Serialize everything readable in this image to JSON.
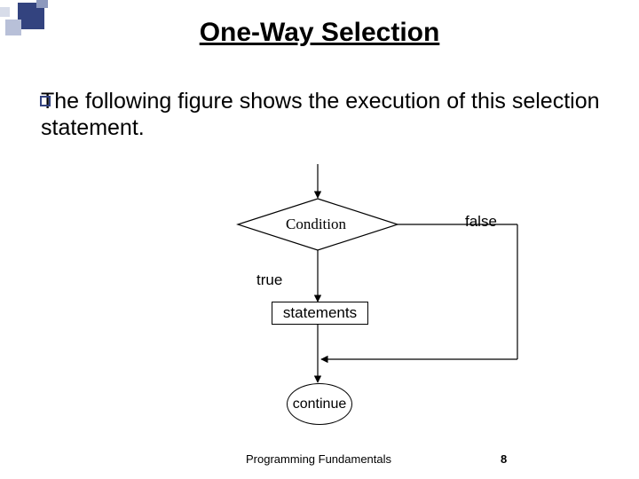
{
  "title": "One-Way Selection",
  "body": "The following figure shows the execution of this selection statement.",
  "flow": {
    "condition": "Condition",
    "true_label": "true",
    "false_label": "false",
    "statements": "statements",
    "continue": "continue"
  },
  "footer": {
    "text": "Programming Fundamentals",
    "page": "8"
  },
  "deco": {
    "c1": "#3c4f8a",
    "c2": "#9aa6c4",
    "c3": "#cfd6e6"
  }
}
